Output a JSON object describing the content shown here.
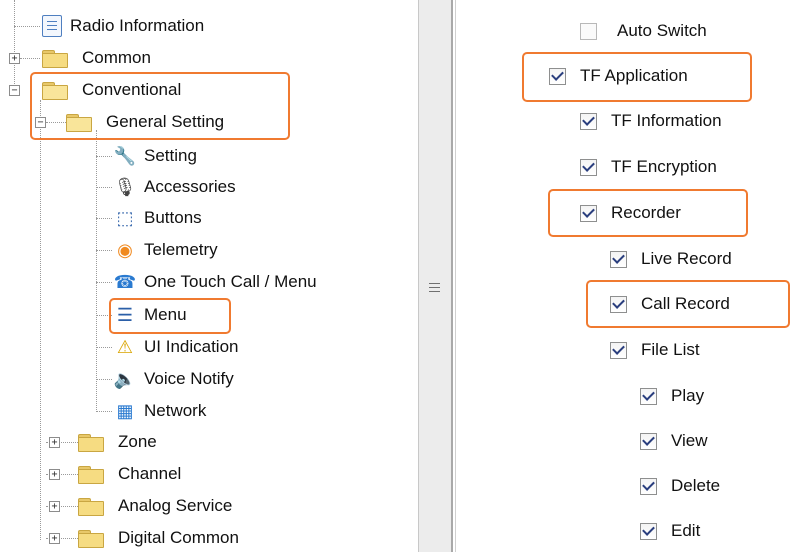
{
  "tree": {
    "items": [
      {
        "label": "Radio Information",
        "icon": "doc-icon"
      },
      {
        "label": "Common",
        "icon": "folder-icon"
      },
      {
        "label": "Conventional",
        "icon": "folder-open-icon"
      },
      {
        "label": "General Setting",
        "icon": "folder-open-icon"
      },
      {
        "label": "Setting",
        "icon": "wrench-icon"
      },
      {
        "label": "Accessories",
        "icon": "accessories-icon"
      },
      {
        "label": "Buttons",
        "icon": "buttons-icon"
      },
      {
        "label": "Telemetry",
        "icon": "telemetry-icon"
      },
      {
        "label": "One Touch Call / Menu",
        "icon": "phone-icon"
      },
      {
        "label": "Menu",
        "icon": "menu-icon"
      },
      {
        "label": "UI Indication",
        "icon": "ui-indication-icon"
      },
      {
        "label": "Voice Notify",
        "icon": "speaker-icon"
      },
      {
        "label": "Network",
        "icon": "network-icon"
      },
      {
        "label": "Zone",
        "icon": "folder-icon"
      },
      {
        "label": "Channel",
        "icon": "folder-icon"
      },
      {
        "label": "Analog Service",
        "icon": "folder-icon"
      },
      {
        "label": "Digital Common",
        "icon": "folder-icon"
      }
    ],
    "expander_plus": "+",
    "expander_minus": "−"
  },
  "menu_options": [
    {
      "label": "Auto Switch",
      "checked": false
    },
    {
      "label": "TF Application",
      "checked": true
    },
    {
      "label": "TF Information",
      "checked": true
    },
    {
      "label": "TF Encryption",
      "checked": true
    },
    {
      "label": "Recorder",
      "checked": true
    },
    {
      "label": "Live Record",
      "checked": true
    },
    {
      "label": "Call Record",
      "checked": true
    },
    {
      "label": "File List",
      "checked": true
    },
    {
      "label": "Play",
      "checked": true
    },
    {
      "label": "View",
      "checked": true
    },
    {
      "label": "Delete",
      "checked": true
    },
    {
      "label": "Edit",
      "checked": true
    }
  ],
  "colors": {
    "highlight": "#f07a30",
    "check": "#2a3e7e",
    "folder": "#f6dc82"
  }
}
